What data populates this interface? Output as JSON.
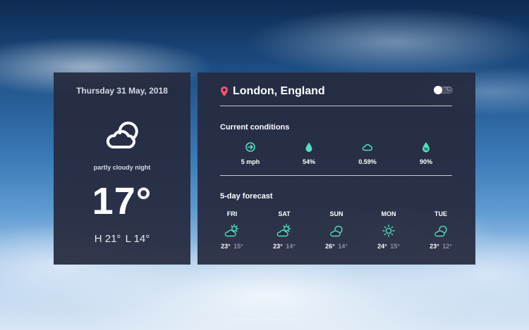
{
  "today": {
    "date": "Thursday 31 May, 2018",
    "icon": "partly-cloudy-night-icon",
    "condition": "partly cloudy night",
    "temperature": "17°",
    "high": "H 21°",
    "low": "L 14°"
  },
  "location": {
    "name": "London, England",
    "icon": "location-pin-icon"
  },
  "toggle": {
    "mark": "°C"
  },
  "current": {
    "title": "Current conditions",
    "items": [
      {
        "icon": "wind-icon",
        "value": "5 mph"
      },
      {
        "icon": "humidity-drop-icon",
        "value": "54%"
      },
      {
        "icon": "cloud-icon",
        "value": "0.59%"
      },
      {
        "icon": "precipitation-icon",
        "value": "90%"
      }
    ]
  },
  "forecast": {
    "title": "5-day forecast",
    "days": [
      {
        "day": "FRI",
        "icon": "partly-cloudy-day-icon",
        "high": "23°",
        "low": "15°"
      },
      {
        "day": "SAT",
        "icon": "partly-cloudy-day-icon",
        "high": "23°",
        "low": "14°"
      },
      {
        "day": "SUN",
        "icon": "cloudy-night-icon",
        "high": "26°",
        "low": "14°"
      },
      {
        "day": "MON",
        "icon": "sun-icon",
        "high": "24°",
        "low": "15°"
      },
      {
        "day": "TUE",
        "icon": "cloudy-night-icon",
        "high": "23°",
        "low": "12°"
      }
    ]
  },
  "footer": {
    "credit": "Created by [unclear] · Powered by Dark Sky"
  },
  "colors": {
    "card": "#262a3e",
    "accent_teal": "#4fe0c0",
    "pin_red": "#ff4d6d",
    "muted": "#8c90a3"
  }
}
